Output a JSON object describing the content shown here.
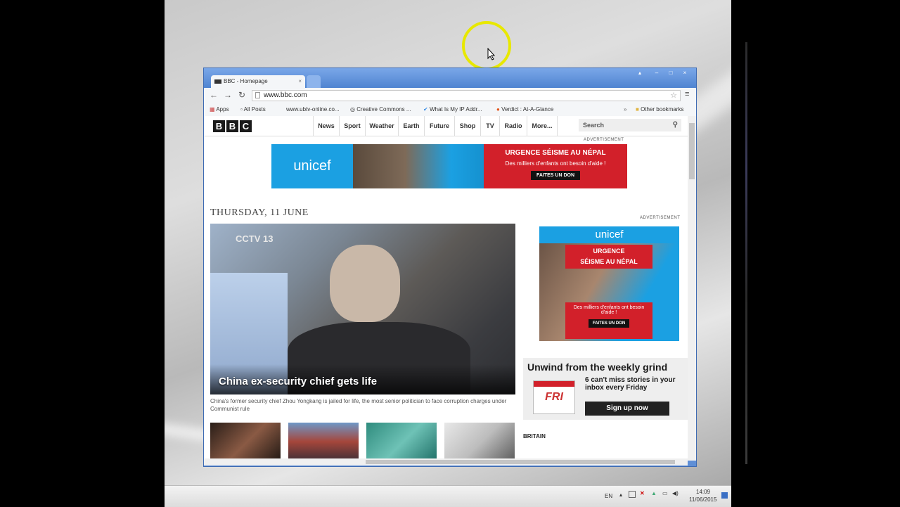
{
  "browser": {
    "tab_title": "BBC - Homepage",
    "url": "www.bbc.com"
  },
  "bookmarks": [
    {
      "label": "Apps"
    },
    {
      "label": "All Posts"
    },
    {
      "label": "www.ubtv-online.co..."
    },
    {
      "label": "Creative Commons ..."
    },
    {
      "label": "What Is My IP Addr..."
    },
    {
      "label": "Verdict : At-A-Glance"
    },
    {
      "label": "Other bookmarks"
    }
  ],
  "site": {
    "logo": [
      "B",
      "B",
      "C"
    ],
    "nav": [
      "News",
      "Sport",
      "Weather",
      "Earth",
      "Future",
      "Shop",
      "TV",
      "Radio",
      "More..."
    ],
    "search_placeholder": "Search",
    "advertisement_label": "ADVERTISEMENT",
    "date_heading": "THURSDAY, 11 JUNE"
  },
  "top_ad": {
    "brand": "unicef",
    "headline": "URGENCE SÉISME AU NÉPAL",
    "subline": "Des milliers d'enfants ont besoin d'aide !",
    "cta": "FAITES UN DON"
  },
  "side_ad": {
    "brand": "unicef",
    "headline_1": "URGENCE",
    "headline_2": "SÉISME AU NÉPAL",
    "subline": "Des milliers d'enfants ont besoin d'aide !",
    "cta": "FAITES UN DON"
  },
  "lead_story": {
    "broadcast_logo": "CCTV 13",
    "headline": "China ex-security chief gets life",
    "summary": "China's former security chief Zhou Yongkang is jailed for life, the most senior politician to face corruption charges under Communist rule"
  },
  "newsletter": {
    "title": "Unwind from the weekly grind",
    "calendar_text": "FRI",
    "body": "6 can't miss stories in your inbox every Friday",
    "button": "Sign up now"
  },
  "section_label": "BRITAIN",
  "taskbar": {
    "language": "EN",
    "time": "14:09",
    "date": "11/06/2015"
  },
  "colors": {
    "unicef_blue": "#1ba0e2",
    "ad_red": "#d2202a",
    "chrome_blue": "#4f84d1"
  }
}
